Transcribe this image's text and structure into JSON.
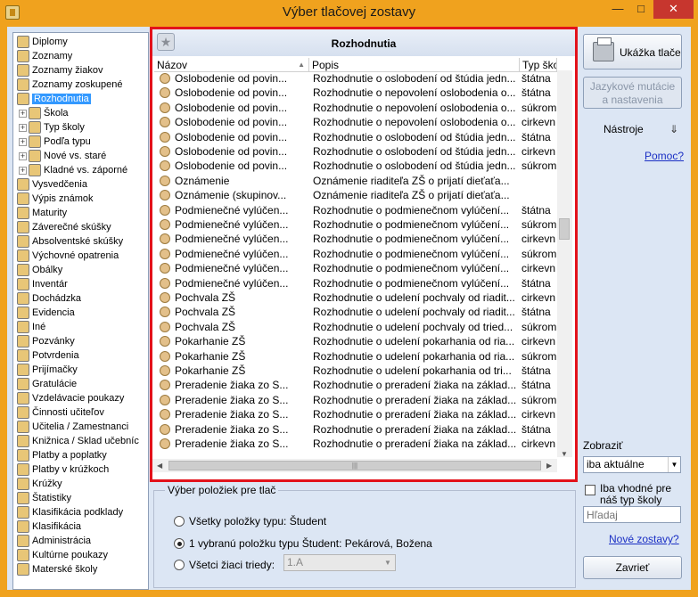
{
  "window": {
    "title": "Výber tlačovej zostavy"
  },
  "tree": {
    "items": [
      {
        "label": "Diplomy",
        "indent": 0
      },
      {
        "label": "Zoznamy",
        "indent": 0
      },
      {
        "label": "Zoznamy žiakov",
        "indent": 0
      },
      {
        "label": "Zoznamy zoskupené",
        "indent": 0
      },
      {
        "label": "Rozhodnutia",
        "indent": 0,
        "selected": true
      },
      {
        "label": "Škola",
        "indent": 1,
        "expander": true
      },
      {
        "label": "Typ školy",
        "indent": 1,
        "expander": true
      },
      {
        "label": "Podľa typu",
        "indent": 1,
        "expander": true
      },
      {
        "label": "Nové vs. staré",
        "indent": 1,
        "expander": true
      },
      {
        "label": "Kladné vs. záporné",
        "indent": 1,
        "expander": true
      },
      {
        "label": "Vysvedčenia",
        "indent": 0
      },
      {
        "label": "Výpis známok",
        "indent": 0
      },
      {
        "label": "Maturity",
        "indent": 0
      },
      {
        "label": "Záverečné skúšky",
        "indent": 0
      },
      {
        "label": "Absolventské skúšky",
        "indent": 0
      },
      {
        "label": "Výchovné opatrenia",
        "indent": 0
      },
      {
        "label": "Obálky",
        "indent": 0
      },
      {
        "label": "Inventár",
        "indent": 0
      },
      {
        "label": "Dochádzka",
        "indent": 0
      },
      {
        "label": "Evidencia",
        "indent": 0
      },
      {
        "label": "Iné",
        "indent": 0
      },
      {
        "label": "Pozvánky",
        "indent": 0
      },
      {
        "label": "Potvrdenia",
        "indent": 0
      },
      {
        "label": "Prijímačky",
        "indent": 0
      },
      {
        "label": "Gratulácie",
        "indent": 0
      },
      {
        "label": "Vzdelávacie poukazy",
        "indent": 0
      },
      {
        "label": "Činnosti učiteľov",
        "indent": 0
      },
      {
        "label": "Učitelia / Zamestnanci",
        "indent": 0
      },
      {
        "label": "Knižnica / Sklad učebníc",
        "indent": 0
      },
      {
        "label": "Platby a poplatky",
        "indent": 0
      },
      {
        "label": "Platby v krúžkoch",
        "indent": 0
      },
      {
        "label": "Krúžky",
        "indent": 0
      },
      {
        "label": "Štatistiky",
        "indent": 0
      },
      {
        "label": "Klasifikácia podklady",
        "indent": 0
      },
      {
        "label": "Klasifikácia",
        "indent": 0
      },
      {
        "label": "Administrácia",
        "indent": 0
      },
      {
        "label": "Kultúrne poukazy",
        "indent": 0
      },
      {
        "label": "Materské školy",
        "indent": 0
      }
    ]
  },
  "panel": {
    "title": "Rozhodnutia",
    "columns": [
      "Názov",
      "Popis",
      "Typ ško"
    ],
    "rows": [
      [
        "Oslobodenie od povin...",
        "Rozhodnutie o oslobodení od štúdia jedn...",
        "štátna"
      ],
      [
        "Oslobodenie od povin...",
        "Rozhodnutie o nepovolení oslobodenia o...",
        "štátna"
      ],
      [
        "Oslobodenie od povin...",
        "Rozhodnutie o nepovolení oslobodenia o...",
        "súkrom"
      ],
      [
        "Oslobodenie od povin...",
        "Rozhodnutie o nepovolení oslobodenia o...",
        "cirkevn"
      ],
      [
        "Oslobodenie od povin...",
        "Rozhodnutie o oslobodení od štúdia jedn...",
        "štátna"
      ],
      [
        "Oslobodenie od povin...",
        "Rozhodnutie o oslobodení od štúdia jedn...",
        "cirkevn"
      ],
      [
        "Oslobodenie od povin...",
        "Rozhodnutie o oslobodení od štúdia jedn...",
        "súkrom"
      ],
      [
        "Oznámenie",
        "Oznámenie riaditeľa ZŠ o prijatí dieťaťa...",
        ""
      ],
      [
        "Oznámenie (skupinov...",
        "Oznámenie riaditeľa ZŠ o prijatí dieťaťa...",
        ""
      ],
      [
        "Podmienečné vylúčen...",
        "Rozhodnutie o podmienečnom vylúčení...",
        "štátna"
      ],
      [
        "Podmienečné vylúčen...",
        "Rozhodnutie o podmienečnom vylúčení...",
        "súkrom"
      ],
      [
        "Podmienečné vylúčen...",
        "Rozhodnutie o podmienečnom vylúčení...",
        "cirkevn"
      ],
      [
        "Podmienečné vylúčen...",
        "Rozhodnutie o podmienečnom vylúčení...",
        "súkrom"
      ],
      [
        "Podmienečné vylúčen...",
        "Rozhodnutie o podmienečnom vylúčení...",
        "cirkevn"
      ],
      [
        "Podmienečné vylúčen...",
        "Rozhodnutie o podmienečnom vylúčení...",
        "štátna"
      ],
      [
        "Pochvala ZŠ",
        "Rozhodnutie o udelení pochvaly od riadit...",
        "cirkevn"
      ],
      [
        "Pochvala ZŠ",
        "Rozhodnutie o udelení pochvaly od riadit...",
        "štátna"
      ],
      [
        "Pochvala ZŠ",
        "Rozhodnutie o udelení pochvaly od tried...",
        "súkrom"
      ],
      [
        "Pokarhanie ZŠ",
        "Rozhodnutie o udelení pokarhania od ria...",
        "cirkevn"
      ],
      [
        "Pokarhanie ZŠ",
        "Rozhodnutie o udelení pokarhania od ria...",
        "súkrom"
      ],
      [
        "Pokarhanie ZŠ",
        "Rozhodnutie o udelení pokarhania od tri...",
        "štátna"
      ],
      [
        "Preradenie žiaka zo S...",
        "Rozhodnutie o preradení žiaka na základ...",
        "štátna"
      ],
      [
        "Preradenie žiaka zo S...",
        "Rozhodnutie o preradení žiaka na základ...",
        "súkrom"
      ],
      [
        "Preradenie žiaka zo S...",
        "Rozhodnutie o preradení žiaka na základ...",
        "cirkevn"
      ],
      [
        "Preradenie žiaka zo S...",
        "Rozhodnutie o preradení žiaka na základ...",
        "štátna"
      ],
      [
        "Preradenie žiaka zo S...",
        "Rozhodnutie o preradení žiaka na základ...",
        "cirkevn"
      ]
    ]
  },
  "selection": {
    "legend": "Výber položiek pre tlač",
    "options": [
      {
        "label": "Všetky položky typu: Študent",
        "checked": false
      },
      {
        "label": "1 vybranú položku typu Študent: Pekárová, Božena",
        "checked": true
      },
      {
        "label": "Všetci žiaci triedy:",
        "checked": false
      }
    ],
    "class_value": "1.A"
  },
  "right": {
    "preview_label": "Ukážka tlače",
    "lang_label_1": "Jazykové mutácie",
    "lang_label_2": "a nastavenia",
    "tools_label": "Nástroje",
    "help_link": "Pomoc?",
    "show_label": "Zobraziť",
    "show_value": "iba aktuálne",
    "checkbox_label_1": "Iba vhodné pre",
    "checkbox_label_2": "náš typ školy",
    "search_placeholder": "Hľadaj",
    "new_reports_link": "Nové zostavy?",
    "close_label": "Zavrieť"
  },
  "colors": {
    "title_bar": "#f0a21e",
    "frame_highlight": "#e3121b",
    "selection": "#3399ff",
    "close_button": "#c7362e"
  }
}
